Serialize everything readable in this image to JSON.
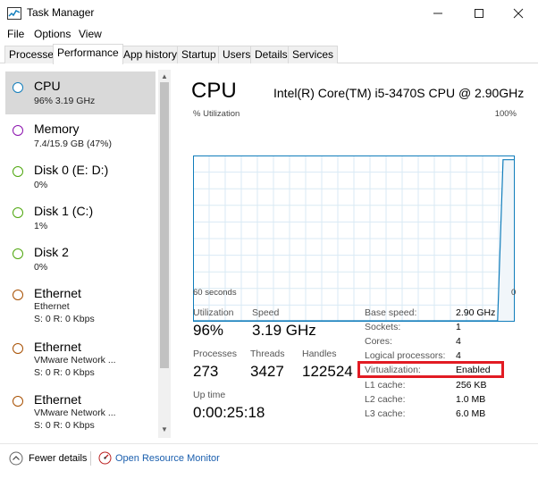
{
  "window": {
    "title": "Task Manager"
  },
  "menu": [
    "File",
    "Options",
    "View"
  ],
  "tabs": [
    "Processes",
    "Performance",
    "App history",
    "Startup",
    "Users",
    "Details",
    "Services"
  ],
  "sidebar": [
    {
      "title": "CPU",
      "sub1": "96%  3.19 GHz",
      "sub2": "",
      "color": "#117dbb",
      "selected": true
    },
    {
      "title": "Memory",
      "sub1": "7.4/15.9 GB (47%)",
      "sub2": "",
      "color": "#8b12ae"
    },
    {
      "title": "Disk 0 (E: D:)",
      "sub1": "0%",
      "sub2": "",
      "color": "#4da60c"
    },
    {
      "title": "Disk 1 (C:)",
      "sub1": "1%",
      "sub2": "",
      "color": "#4da60c"
    },
    {
      "title": "Disk 2",
      "sub1": "0%",
      "sub2": "",
      "color": "#4da60c"
    },
    {
      "title": "Ethernet",
      "sub1": "Ethernet",
      "sub2": "S: 0  R: 0 Kbps",
      "color": "#a74f01"
    },
    {
      "title": "Ethernet",
      "sub1": "VMware Network ...",
      "sub2": "S: 0  R: 0 Kbps",
      "color": "#a74f01"
    },
    {
      "title": "Ethernet",
      "sub1": "VMware Network ...",
      "sub2": "S: 0  R: 0 Kbps",
      "color": "#a74f01"
    }
  ],
  "cpu": {
    "heading": "CPU",
    "model": "Intel(R) Core(TM) i5-3470S CPU @ 2.90GHz",
    "util_label": "% Utilization",
    "util_max": "100%",
    "time_left": "60 seconds",
    "time_right": "0",
    "graph_color": "#117dbb",
    "graph_fill": "#f1f6fa",
    "history": [
      0,
      0,
      0,
      0,
      0,
      0,
      0,
      0,
      0,
      0,
      0,
      0,
      0,
      0,
      0,
      0,
      0,
      0,
      0,
      0,
      0,
      0,
      0,
      0,
      0,
      0,
      0,
      0,
      0,
      0,
      0,
      0,
      0,
      0,
      0,
      0,
      0,
      0,
      0,
      0,
      0,
      0,
      0,
      0,
      0,
      0,
      0,
      0,
      0,
      0,
      0,
      0,
      0,
      0,
      0,
      0,
      0,
      98,
      98,
      98
    ]
  },
  "stats": {
    "utilization_label": "Utilization",
    "utilization": "96%",
    "speed_label": "Speed",
    "speed": "3.19 GHz",
    "processes_label": "Processes",
    "processes": "273",
    "threads_label": "Threads",
    "threads": "3427",
    "handles_label": "Handles",
    "handles": "122524",
    "uptime_label": "Up time",
    "uptime": "0:00:25:18"
  },
  "specs": [
    {
      "label": "Base speed:",
      "value": "2.90 GHz"
    },
    {
      "label": "Sockets:",
      "value": "1"
    },
    {
      "label": "Cores:",
      "value": "4"
    },
    {
      "label": "Logical processors:",
      "value": "4"
    },
    {
      "label": "Virtualization:",
      "value": "Enabled"
    },
    {
      "label": "L1 cache:",
      "value": "256 KB"
    },
    {
      "label": "L2 cache:",
      "value": "1.0 MB"
    },
    {
      "label": "L3 cache:",
      "value": "6.0 MB"
    }
  ],
  "footer": {
    "fewer": "Fewer details",
    "monitor": "Open Resource Monitor"
  },
  "colors": {
    "highlight": "#e21b23",
    "link": "#1b5fae"
  }
}
